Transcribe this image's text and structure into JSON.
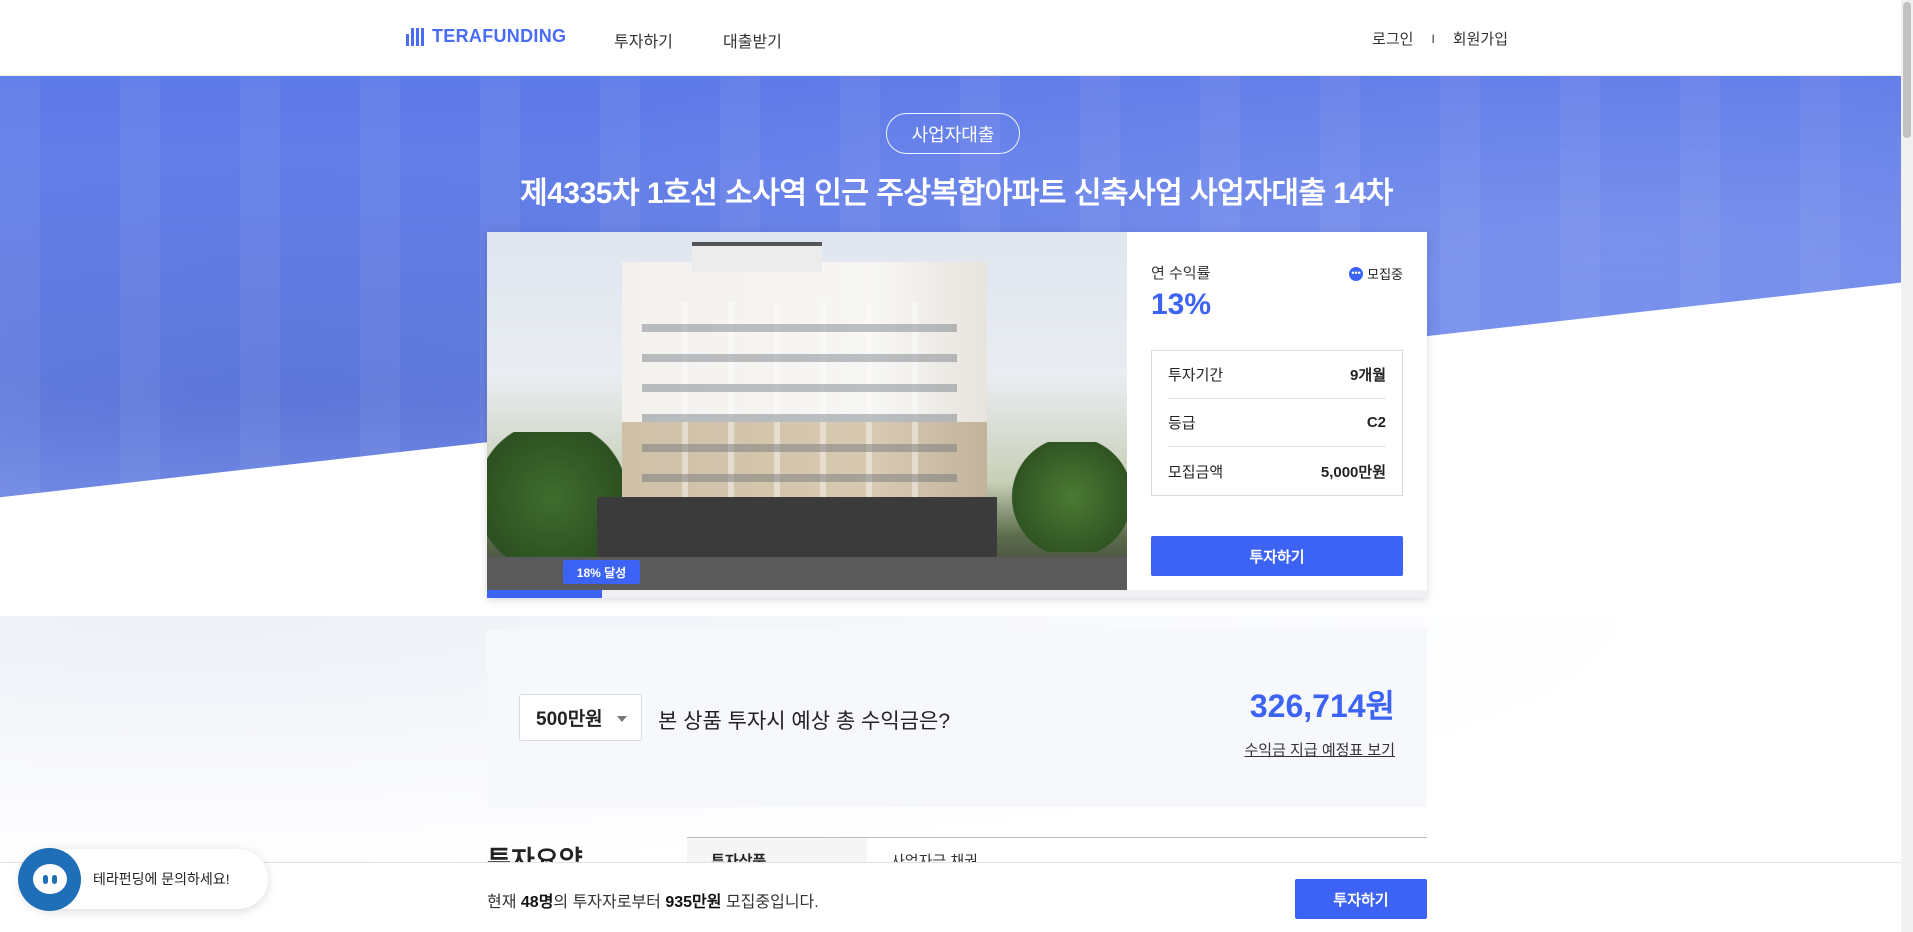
{
  "header": {
    "logo": "TERAFUNDING",
    "nav": [
      "투자하기",
      "대출받기"
    ],
    "login": "로그인",
    "separator": "I",
    "signup": "회원가입"
  },
  "hero": {
    "badge": "사업자대출",
    "title": "제4335차 1호선 소사역 인근 주상복합아파트 신축사업 사업자대출 14차"
  },
  "product": {
    "progress_label": "18% 달성",
    "progress_percent": 18,
    "rate_label": "연 수익률",
    "rate_value": "13%",
    "status": "모집중",
    "stats": [
      {
        "label": "투자기간",
        "value": "9개월"
      },
      {
        "label": "등급",
        "value": "C2"
      },
      {
        "label": "모집금액",
        "value": "5,000만원"
      }
    ],
    "invest_button": "투자하기"
  },
  "calculator": {
    "selected_amount": "500만원",
    "question": "본 상품 투자시 예상 총 수익금은?",
    "expected_return": "326,714원",
    "schedule_link": "수익금 지급 예정표 보기"
  },
  "summary": {
    "title": "투자요약",
    "rows": [
      {
        "key": "투자상품",
        "value": "사업자금 채권"
      }
    ]
  },
  "bottom_bar": {
    "prefix": "현재 ",
    "investors": "48명",
    "middle": "의 투자자로부터 ",
    "amount": "935만원",
    "suffix": " 모집중입니다.",
    "button": "투자하기"
  },
  "chat": {
    "text": "테라펀딩에 문의하세요!"
  },
  "colors": {
    "accent": "#3d63f4",
    "hero": "#5a7bea",
    "chat": "#1e6fb8"
  }
}
